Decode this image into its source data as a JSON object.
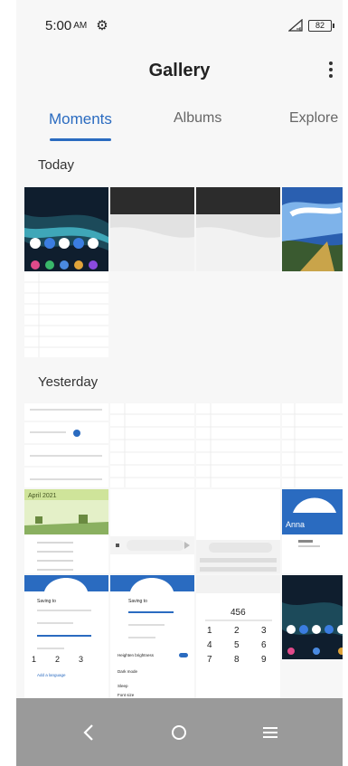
{
  "status_bar": {
    "time": "5:00",
    "ampm": "AM",
    "battery": "82",
    "icons": [
      "gear-icon",
      "signal-icon",
      "battery-icon"
    ]
  },
  "app_bar": {
    "title": "Gallery",
    "more_icon": "more-vert-icon"
  },
  "tabs": [
    {
      "label": "Moments",
      "active": true
    },
    {
      "label": "Albums",
      "active": false
    },
    {
      "label": "Explore",
      "active": false
    }
  ],
  "sections": [
    {
      "header": "Today"
    },
    {
      "header": "Yesterday"
    }
  ],
  "thumbnails": {
    "calendar_month": "April 2021",
    "contact_name": "Anna",
    "dialer_number": "456",
    "keypad": [
      "1",
      "2",
      "3",
      "4",
      "5",
      "6",
      "7",
      "8",
      "9"
    ],
    "settings_lines": [
      "Saving to",
      "Display",
      "Heighten brightness",
      "Dark mode",
      "Sleep",
      "Font size",
      "Add a language"
    ]
  },
  "nav_bar": {
    "back_icon": "back-icon",
    "home_icon": "home-icon",
    "recents_icon": "recents-icon"
  },
  "colors": {
    "accent": "#2a6bc0",
    "nav_bar": "#9a9a9a",
    "background": "#f7f7f7"
  }
}
